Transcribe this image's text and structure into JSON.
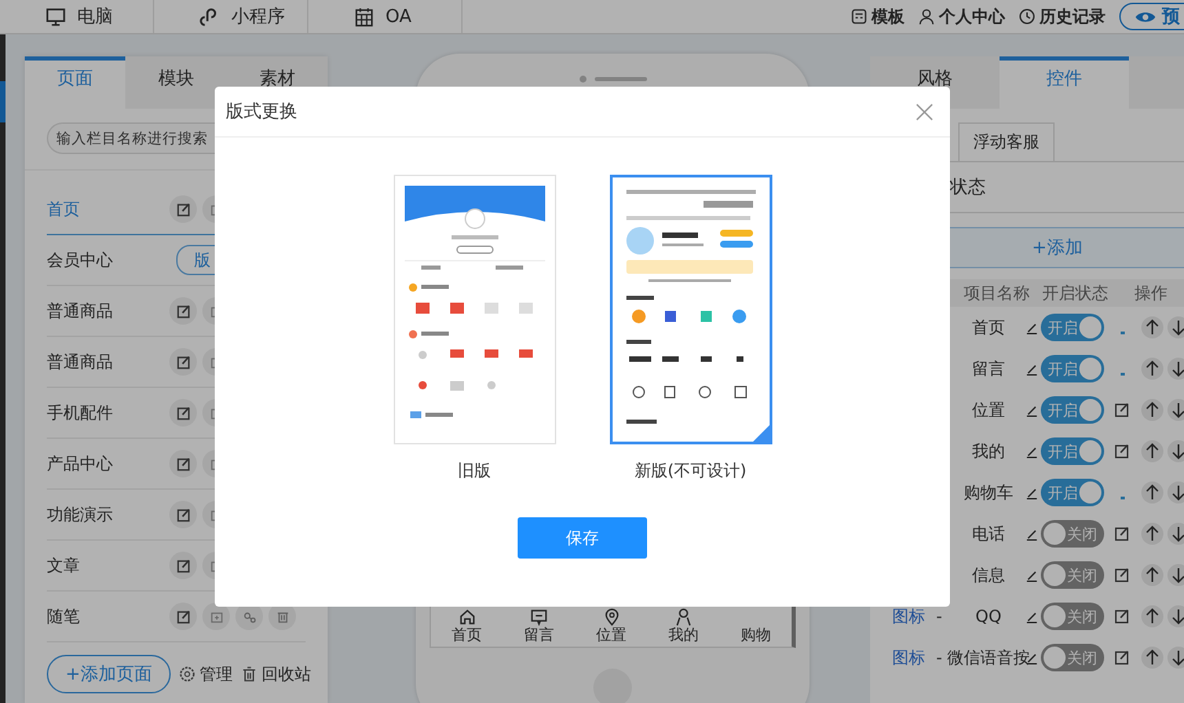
{
  "top_nav": {
    "tabs": [
      {
        "label": "电脑"
      },
      {
        "label": "小程序"
      },
      {
        "label": "OA"
      }
    ],
    "links": [
      {
        "label": "模板"
      },
      {
        "label": "个人中心"
      },
      {
        "label": "历史记录"
      }
    ],
    "preview_button": "预"
  },
  "left_panel": {
    "tabs": [
      {
        "label": "页面",
        "selected": true
      },
      {
        "label": "模块",
        "selected": false
      },
      {
        "label": "素材",
        "selected": false
      }
    ],
    "search": {
      "placeholder": "输入栏目名称进行搜索"
    },
    "pages": [
      {
        "name": "首页",
        "selected": true
      },
      {
        "name": "会员中心",
        "selected": false,
        "badge": "版"
      },
      {
        "name": "普通商品",
        "selected": false
      },
      {
        "name": "普通商品",
        "selected": false
      },
      {
        "name": "手机配件",
        "selected": false
      },
      {
        "name": "产品中心",
        "selected": false
      },
      {
        "name": "功能演示",
        "selected": false
      },
      {
        "name": "文章",
        "selected": false
      },
      {
        "name": "随笔",
        "selected": false,
        "tools": true
      }
    ],
    "add_button": "+添加页面",
    "manage": "管理",
    "recycle": "回收站"
  },
  "phone": {
    "nav": [
      "首页",
      "留言",
      "位置",
      "我的",
      "购物"
    ]
  },
  "right_panel": {
    "tabs": [
      {
        "label": "风格",
        "selected": false
      },
      {
        "label": "控件",
        "selected": true
      }
    ],
    "sub_tab": "浮动客服",
    "status_label": "状态",
    "add_button": "+添加",
    "columns": [
      "项目名称",
      "开启状态",
      "操作"
    ],
    "rows": [
      {
        "name": "首页",
        "on": true,
        "toggle": "开启",
        "editable": false
      },
      {
        "name": "留言",
        "on": true,
        "toggle": "开启",
        "editable": false
      },
      {
        "name": "位置",
        "on": true,
        "toggle": "开启",
        "editable": true
      },
      {
        "name": "我的",
        "on": true,
        "toggle": "开启",
        "editable": true
      },
      {
        "name": "购物车",
        "on": true,
        "toggle": "开启",
        "editable": false
      },
      {
        "name": "电话",
        "on": false,
        "toggle": "关闭",
        "editable": true
      },
      {
        "name": "信息",
        "on": false,
        "toggle": "关闭",
        "editable": true
      },
      {
        "icon_link": "图标",
        "dash": "-",
        "name": "QQ",
        "on": false,
        "toggle": "关闭",
        "editable": true
      },
      {
        "icon_link": "图标",
        "dash": "-",
        "name": "微信语音按",
        "on": false,
        "toggle": "关闭",
        "editable": true
      }
    ]
  },
  "modal": {
    "title": "版式更换",
    "options": [
      {
        "caption": "旧版",
        "selected": false
      },
      {
        "caption": "新版(不可设计)",
        "selected": true
      }
    ],
    "save": "保存"
  }
}
